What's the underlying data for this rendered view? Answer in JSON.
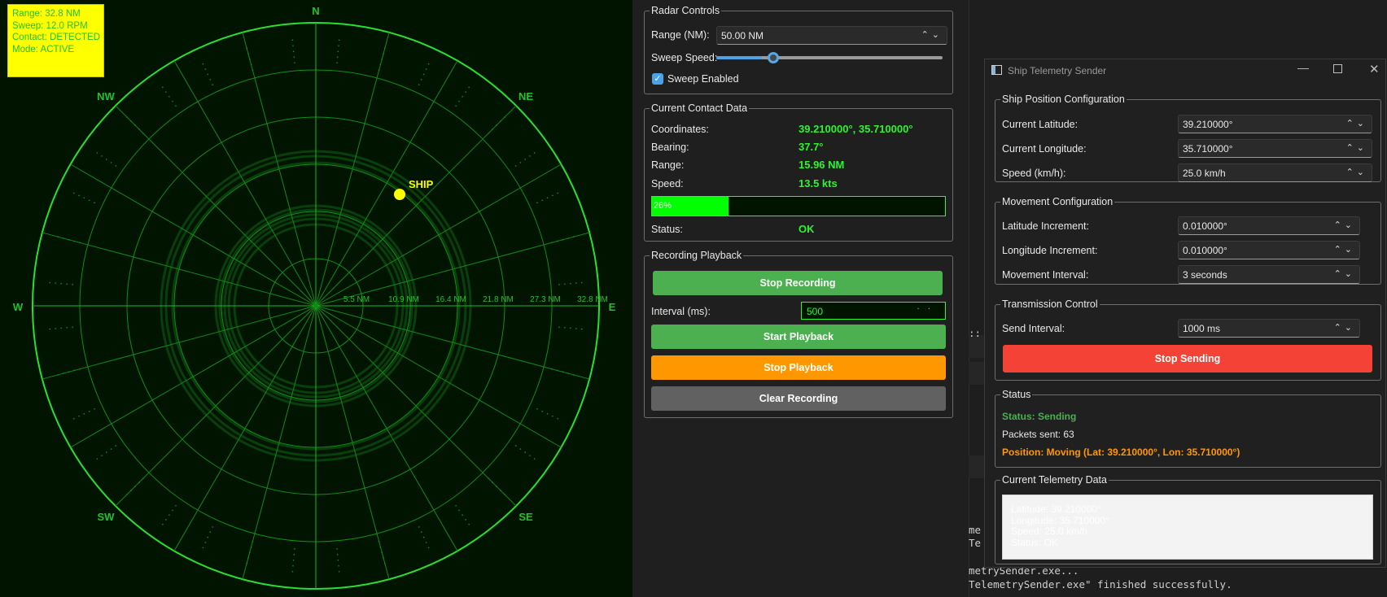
{
  "radar": {
    "info": {
      "range": "Range: 32.8 NM",
      "sweep": "Sweep: 12.0 RPM",
      "contact": "Contact: DETECTED",
      "mode": "Mode: ACTIVE"
    },
    "compass": {
      "n": "N",
      "ne": "NE",
      "e": "E",
      "se": "SE",
      "s": "S",
      "sw": "SW",
      "w": "W",
      "nw": "NW"
    },
    "range_rings": [
      "5.5 NM",
      "10.9 NM",
      "16.4 NM",
      "21.8 NM",
      "27.3 NM",
      "32.8 NM"
    ],
    "ship_label": "SHIP",
    "colors": {
      "background": "#001400",
      "grid": "#22c22a",
      "ship": "#ffff00"
    }
  },
  "radar_controls": {
    "title": "Radar Controls",
    "range_label": "Range (NM):",
    "range_value": "50.00 NM",
    "sweep_speed_label": "Sweep Speed:",
    "sweep_speed_fraction": 0.2,
    "sweep_enabled_label": "Sweep Enabled",
    "sweep_enabled": true
  },
  "contact": {
    "title": "Current Contact Data",
    "coordinates_label": "Coordinates:",
    "coordinates": "39.210000°, 35.710000°",
    "bearing_label": "Bearing:",
    "bearing": "37.7°",
    "range_label": "Range:",
    "range": "15.96 NM",
    "speed_label": "Speed:",
    "speed": "13.5 kts",
    "progress_text": "26%",
    "progress": 0.26,
    "status_label": "Status:",
    "status": "OK"
  },
  "recording": {
    "title": "Recording  Playback",
    "stop_recording": "Stop Recording",
    "interval_label": "Interval (ms):",
    "interval_value": "500",
    "start_playback": "Start Playback",
    "stop_playback": "Stop Playback",
    "clear_recording": "Clear Recording"
  },
  "terminal": {
    "line1": "::",
    "line2": "me",
    "line3": "Te",
    "line4": "metrySender.exe...",
    "line5": "TelemetrySender.exe\" finished successfully."
  },
  "sender": {
    "window_title": "Ship Telemetry Sender",
    "position": {
      "title": "Ship Position Configuration",
      "lat_label": "Current Latitude:",
      "lat": "39.210000°",
      "lon_label": "Current Longitude:",
      "lon": "35.710000°",
      "speed_label": "Speed (km/h):",
      "speed": "25.0 km/h"
    },
    "movement": {
      "title": "Movement Configuration",
      "lat_inc_label": "Latitude Increment:",
      "lat_inc": "0.010000°",
      "lon_inc_label": "Longitude Increment:",
      "lon_inc": "0.010000°",
      "interval_label": "Movement Interval:",
      "interval": "3 seconds"
    },
    "transmission": {
      "title": "Transmission Control",
      "send_interval_label": "Send Interval:",
      "send_interval": "1000 ms",
      "stop_sending": "Stop Sending"
    },
    "status": {
      "title": "Status",
      "status_text": "Status: Sending",
      "packets": "Packets sent: 63",
      "position_text": "Position: Moving (Lat: 39.210000°, Lon: 35.710000°)"
    },
    "telemetry": {
      "title": "Current Telemetry Data",
      "lines": [
        "Latitude: 39.210000°",
        "Longitude: 35.710000°",
        "Speed: 25.0 km/h",
        "Status: OK"
      ]
    }
  }
}
